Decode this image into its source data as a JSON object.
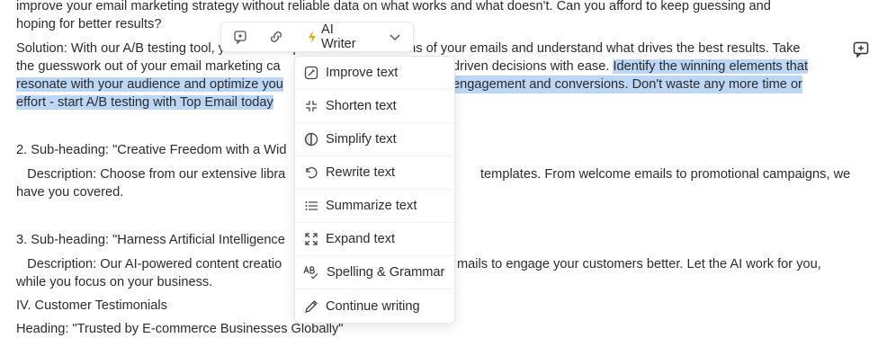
{
  "document": {
    "lines": [
      "improve your email marketing strategy without reliable data on what works and what doesn't. Can you afford to keep guessing and",
      "hoping for better results?",
      "Solution: With our A/B testing tool, you can compare different versions of your emails and understand what drives the best results. Take",
      "the guesswork out of your email marketing ca",
      "driven decisions with ease. ",
      "Identify the winning elements that",
      "resonate with your audience and optimize you",
      "engagement and conversions. Don't waste any more time or",
      "effort - start A/B testing with Top Email today",
      "2. Sub-heading: \"Creative Freedom with a Wid",
      "   Description: Choose from our extensive libra",
      "templates. From welcome emails to promotional campaigns, we",
      "have you covered.",
      "3. Sub-heading: \"Harness Artificial Intelligence",
      "   Description: Our AI-powered content creatio",
      "mails to engage your customers better. Let the AI work for you,",
      "while you focus on your business.",
      "IV. Customer Testimonials",
      "Heading: \"Trusted by E-commerce Businesses Globally\""
    ]
  },
  "toolbar": {
    "ai_writer_label": "AI Writer"
  },
  "ai_menu": {
    "items": [
      {
        "label": "Improve text",
        "icon": "improve-icon"
      },
      {
        "label": "Shorten text",
        "icon": "shorten-icon"
      },
      {
        "label": "Simplify text",
        "icon": "simplify-icon"
      },
      {
        "label": "Rewrite text",
        "icon": "rewrite-icon"
      },
      {
        "label": "Summarize text",
        "icon": "summarize-icon"
      },
      {
        "label": "Expand text",
        "icon": "expand-icon"
      },
      {
        "label": "Spelling & Grammar",
        "icon": "spelling-icon"
      },
      {
        "label": "Continue writing",
        "icon": "pencil-icon"
      }
    ]
  },
  "colors": {
    "selection_highlight": "#bcd6f5",
    "text": "#2b2b2b",
    "lightning_accent": "#e6a817"
  }
}
